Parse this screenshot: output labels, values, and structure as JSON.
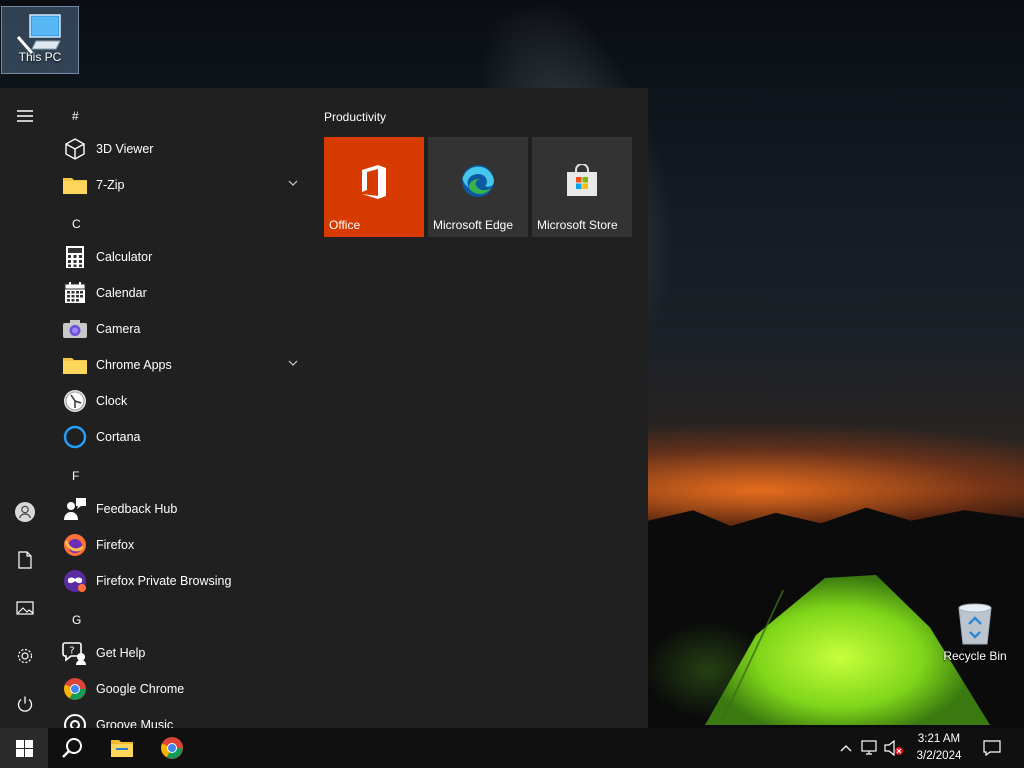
{
  "desktop": {
    "icons": [
      {
        "label": "This PC"
      },
      {
        "label": "Recycle Bin"
      }
    ]
  },
  "start_menu": {
    "rail": {
      "items": [
        "menu",
        "account",
        "documents",
        "pictures",
        "settings",
        "power"
      ]
    },
    "app_list": [
      {
        "type": "letter",
        "text": "#"
      },
      {
        "type": "app",
        "text": "3D Viewer",
        "icon": "3d-viewer-icon"
      },
      {
        "type": "folder",
        "text": "7-Zip",
        "icon": "folder-icon",
        "expandable": true
      },
      {
        "type": "letter",
        "text": "C"
      },
      {
        "type": "app",
        "text": "Calculator",
        "icon": "calculator-icon"
      },
      {
        "type": "app",
        "text": "Calendar",
        "icon": "calendar-icon"
      },
      {
        "type": "app",
        "text": "Camera",
        "icon": "camera-icon"
      },
      {
        "type": "folder",
        "text": "Chrome Apps",
        "icon": "folder-icon",
        "expandable": true
      },
      {
        "type": "app",
        "text": "Clock",
        "icon": "clock-icon"
      },
      {
        "type": "app",
        "text": "Cortana",
        "icon": "cortana-icon"
      },
      {
        "type": "letter",
        "text": "F"
      },
      {
        "type": "app",
        "text": "Feedback Hub",
        "icon": "feedback-hub-icon"
      },
      {
        "type": "app",
        "text": "Firefox",
        "icon": "firefox-icon"
      },
      {
        "type": "app",
        "text": "Firefox Private Browsing",
        "icon": "firefox-private-icon"
      },
      {
        "type": "letter",
        "text": "G"
      },
      {
        "type": "app",
        "text": "Get Help",
        "icon": "get-help-icon"
      },
      {
        "type": "app",
        "text": "Google Chrome",
        "icon": "chrome-icon"
      },
      {
        "type": "app",
        "text": "Groove Music",
        "icon": "groove-music-icon"
      }
    ],
    "tiles": {
      "group_title": "Productivity",
      "items": [
        {
          "label": "Office",
          "icon": "office-icon",
          "color": "#d83b01"
        },
        {
          "label": "Microsoft Edge",
          "icon": "edge-icon",
          "color": "#333333"
        },
        {
          "label": "Microsoft Store",
          "icon": "store-icon",
          "color": "#333333"
        }
      ]
    }
  },
  "taskbar": {
    "pinned": [
      "start-icon",
      "search-icon",
      "file-explorer-icon",
      "chrome-icon"
    ],
    "clock": {
      "time": "3:21 AM",
      "date": "3/2/2024"
    }
  }
}
